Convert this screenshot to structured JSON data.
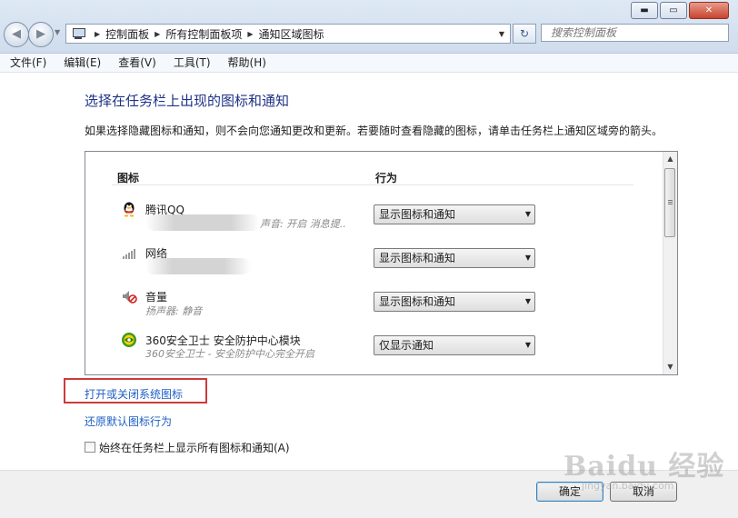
{
  "window": {
    "breadcrumb": [
      "控制面板",
      "所有控制面板项",
      "通知区域图标"
    ],
    "search_placeholder": "搜索控制面板"
  },
  "menubar": [
    "文件(F)",
    "编辑(E)",
    "查看(V)",
    "工具(T)",
    "帮助(H)"
  ],
  "page": {
    "heading": "选择在任务栏上出现的图标和通知",
    "description": "如果选择隐藏图标和通知，则不会向您通知更改和更新。若要随时查看隐藏的图标，请单击任务栏上通知区域旁的箭头。"
  },
  "list": {
    "col_icon": "图标",
    "col_behavior": "行为",
    "rows": [
      {
        "icon": "qq-penguin-icon",
        "name": "腾讯QQ",
        "subtitle": "声音: 开启 消息提..",
        "behavior": "显示图标和通知"
      },
      {
        "icon": "network-icon",
        "name": "网络",
        "subtitle": "",
        "behavior": "显示图标和通知"
      },
      {
        "icon": "volume-muted-icon",
        "name": "音量",
        "subtitle": "扬声器: 静音",
        "behavior": "显示图标和通知"
      },
      {
        "icon": "360-safeguard-icon",
        "name": "360安全卫士 安全防护中心模块",
        "subtitle": "360安全卫士 - 安全防护中心完全开启",
        "behavior": "仅显示通知"
      }
    ]
  },
  "links": {
    "system_icons": "打开或关闭系统图标",
    "restore_default": "还原默认图标行为"
  },
  "checkbox": {
    "label": "始终在任务栏上显示所有图标和通知(A)",
    "checked": false
  },
  "buttons": {
    "ok": "确定",
    "cancel": "取消"
  },
  "watermark": {
    "text": "Baidu 经验",
    "url": "jingyan.baidu.com"
  },
  "colors": {
    "heading": "#1e3287",
    "link": "#1e5fc4",
    "highlight_box": "#cc3b3b"
  }
}
